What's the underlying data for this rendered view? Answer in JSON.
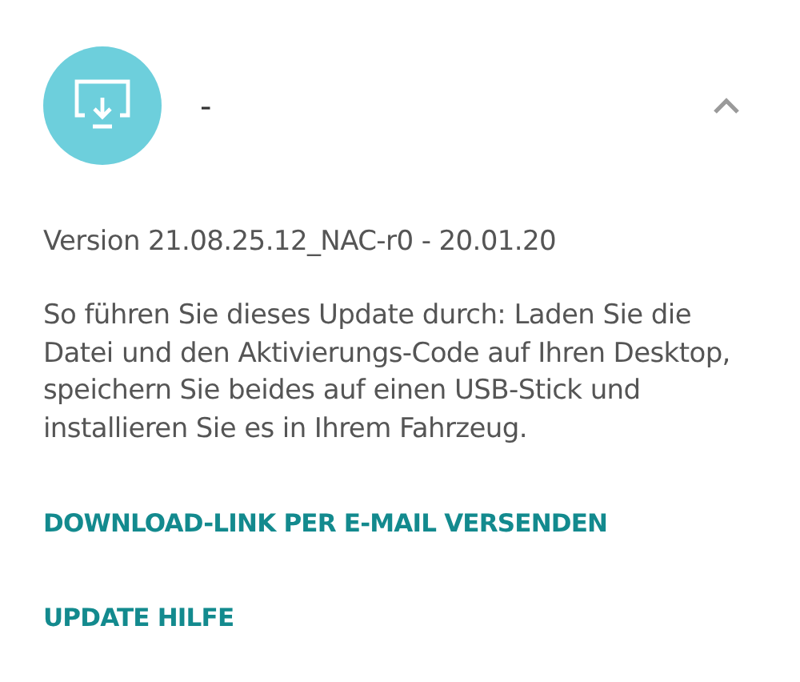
{
  "update": {
    "title": "-",
    "expanded": true,
    "version": "Version 21.08.25.12_NAC-r0 - 20.01.20",
    "instructions": "So führen Sie dieses Update durch: Laden Sie die Datei und den Aktivierungs-Code auf Ihren Desktop, speichern Sie beides auf einen USB-Stick und installieren Sie es in Ihrem Fahrzeug.",
    "links": [
      {
        "label": "DOWNLOAD-LINK PER E-MAIL VERSENDEN"
      },
      {
        "label": "UPDATE HILFE"
      }
    ]
  }
}
